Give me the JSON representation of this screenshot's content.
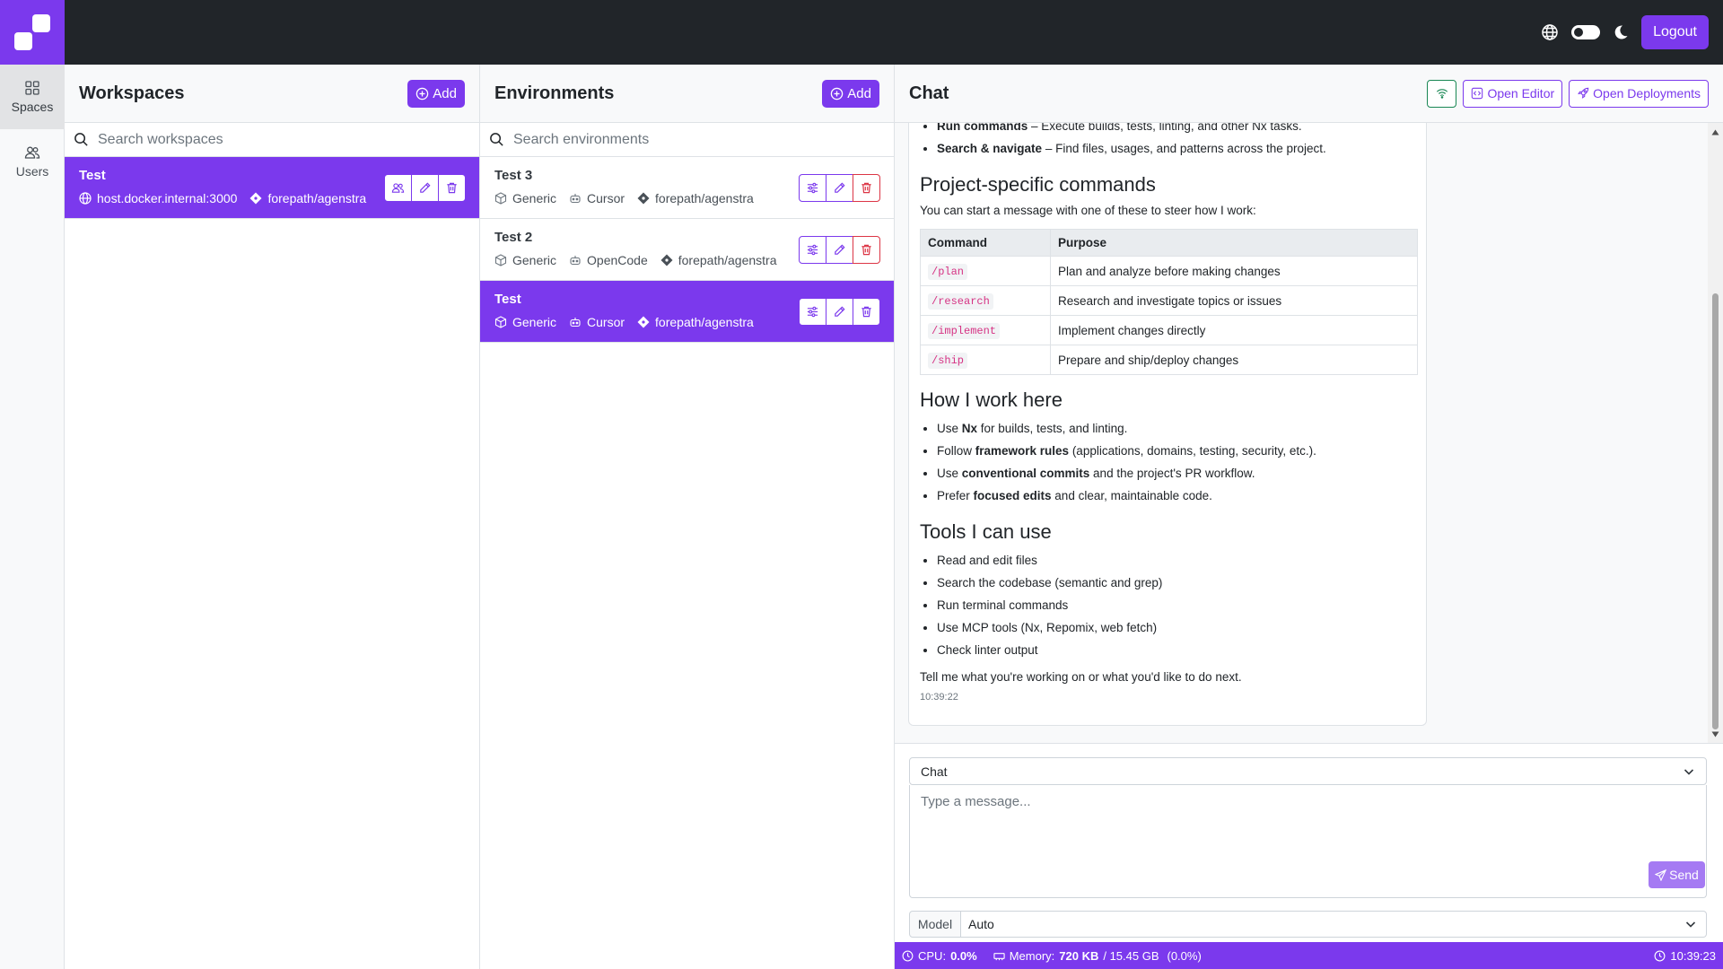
{
  "app": {
    "logout_label": "Logout"
  },
  "nav": {
    "items": [
      {
        "label": "Spaces",
        "icon": "grid-icon",
        "active": true
      },
      {
        "label": "Users",
        "icon": "users-icon",
        "active": false
      }
    ]
  },
  "workspaces": {
    "title": "Workspaces",
    "add_label": "Add",
    "search_placeholder": "Search workspaces",
    "items": [
      {
        "name": "Test",
        "host": "host.docker.internal:3000",
        "repo": "forepath/agenstra",
        "selected": true
      }
    ]
  },
  "environments": {
    "title": "Environments",
    "add_label": "Add",
    "search_placeholder": "Search environments",
    "items": [
      {
        "name": "Test 3",
        "type": "Generic",
        "agent": "Cursor",
        "repo": "forepath/agenstra",
        "selected": false
      },
      {
        "name": "Test 2",
        "type": "Generic",
        "agent": "OpenCode",
        "repo": "forepath/agenstra",
        "selected": false
      },
      {
        "name": "Test",
        "type": "Generic",
        "agent": "Cursor",
        "repo": "forepath/agenstra",
        "selected": true
      }
    ]
  },
  "chat": {
    "title": "Chat",
    "open_editor_label": "Open Editor",
    "open_deployments_label": "Open Deployments",
    "message": {
      "top_bullets": [
        {
          "bold": "Run commands",
          "rest": " – Execute builds, tests, linting, and other Nx tasks."
        },
        {
          "bold": "Search & navigate",
          "rest": " – Find files, usages, and patterns across the project."
        }
      ],
      "section1_heading": "Project-specific commands",
      "section1_intro": "You can start a message with one of these to steer how I work:",
      "table_headers": [
        "Command",
        "Purpose"
      ],
      "table_rows": [
        {
          "command": "/plan",
          "purpose": "Plan and analyze before making changes"
        },
        {
          "command": "/research",
          "purpose": "Research and investigate topics or issues"
        },
        {
          "command": "/implement",
          "purpose": "Implement changes directly"
        },
        {
          "command": "/ship",
          "purpose": "Prepare and ship/deploy changes"
        }
      ],
      "section2_heading": "How I work here",
      "section2_bullets": [
        {
          "pre": "Use ",
          "bold": "Nx",
          "rest": " for builds, tests, and linting."
        },
        {
          "pre": "Follow ",
          "bold": "framework rules",
          "rest": " (applications, domains, testing, security, etc.)."
        },
        {
          "pre": "Use ",
          "bold": "conventional commits",
          "rest": " and the project's PR workflow."
        },
        {
          "pre": "Prefer ",
          "bold": "focused edits",
          "rest": " and clear, maintainable code."
        }
      ],
      "section3_heading": "Tools I can use",
      "section3_bullets": [
        "Read and edit files",
        "Search the codebase (semantic and grep)",
        "Run terminal commands",
        "Use MCP tools (Nx, Repomix, web fetch)",
        "Check linter output"
      ],
      "closing": "Tell me what you're working on or what you'd like to do next.",
      "timestamp": "10:39:22"
    },
    "mode_value": "Chat",
    "message_placeholder": "Type a message...",
    "send_label": "Send",
    "model_label": "Model",
    "model_value": "Auto"
  },
  "status": {
    "cpu_label": "CPU:",
    "cpu_value": "0.0%",
    "memory_label": "Memory:",
    "memory_used": "720 KB",
    "memory_total": "/ 15.45 GB",
    "memory_pct": "(0.0%)",
    "time": "10:39:23"
  },
  "colors": {
    "accent": "#7b39ed",
    "topbar": "#212529",
    "danger": "#dc3545",
    "success": "#198754",
    "code": "#d63384"
  }
}
